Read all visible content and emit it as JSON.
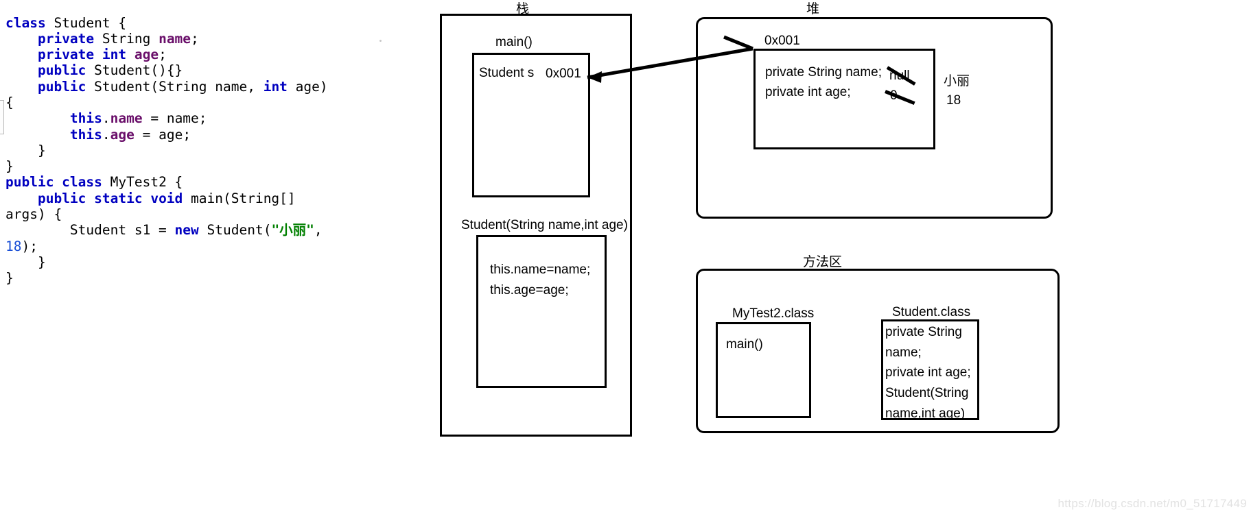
{
  "code": {
    "language": "java",
    "lines": [
      [
        {
          "t": "class ",
          "c": "kw"
        },
        {
          "t": "Student {",
          "c": "plain"
        }
      ],
      [
        {
          "t": "    ",
          "c": "plain"
        },
        {
          "t": "private ",
          "c": "kw"
        },
        {
          "t": "String ",
          "c": "plain"
        },
        {
          "t": "name",
          "c": "fld"
        },
        {
          "t": ";",
          "c": "plain"
        }
      ],
      [
        {
          "t": "    ",
          "c": "plain"
        },
        {
          "t": "private ",
          "c": "kw"
        },
        {
          "t": "int ",
          "c": "kw"
        },
        {
          "t": "age",
          "c": "fld"
        },
        {
          "t": ";",
          "c": "plain"
        }
      ],
      [
        {
          "t": "    ",
          "c": "plain"
        },
        {
          "t": "public ",
          "c": "kw"
        },
        {
          "t": "Student(){}",
          "c": "plain"
        }
      ],
      [
        {
          "t": "    ",
          "c": "plain"
        },
        {
          "t": "public ",
          "c": "kw"
        },
        {
          "t": "Student(String name, ",
          "c": "plain"
        },
        {
          "t": "int ",
          "c": "kw"
        },
        {
          "t": "age){",
          "c": "plain"
        }
      ],
      [
        {
          "t": "        ",
          "c": "plain"
        },
        {
          "t": "this",
          "c": "kw"
        },
        {
          "t": ".",
          "c": "plain"
        },
        {
          "t": "name",
          "c": "fld"
        },
        {
          "t": " = name;",
          "c": "plain"
        }
      ],
      [
        {
          "t": "        ",
          "c": "plain"
        },
        {
          "t": "this",
          "c": "kw"
        },
        {
          "t": ".",
          "c": "plain"
        },
        {
          "t": "age",
          "c": "fld"
        },
        {
          "t": " = age;",
          "c": "plain"
        }
      ],
      [
        {
          "t": "    }",
          "c": "plain"
        }
      ],
      [
        {
          "t": "}",
          "c": "plain"
        }
      ],
      [
        {
          "t": "public class ",
          "c": "kw"
        },
        {
          "t": "MyTest2 {",
          "c": "plain"
        }
      ],
      [
        {
          "t": "    ",
          "c": "plain"
        },
        {
          "t": "public static void ",
          "c": "kw"
        },
        {
          "t": "main(String[] args) {",
          "c": "plain"
        }
      ],
      [
        {
          "t": "        Student s1 = ",
          "c": "plain"
        },
        {
          "t": "new ",
          "c": "kw"
        },
        {
          "t": "Student(",
          "c": "plain"
        },
        {
          "t": "\"小丽\"",
          "c": "str"
        },
        {
          "t": ", ",
          "c": "plain"
        },
        {
          "t": "18",
          "c": "num"
        },
        {
          "t": ");",
          "c": "plain"
        }
      ],
      [
        {
          "t": "    }",
          "c": "plain"
        }
      ],
      [
        {
          "t": "}",
          "c": "plain"
        }
      ]
    ]
  },
  "diagram": {
    "stack": {
      "label": "栈",
      "main_frame": {
        "label": "main()",
        "variable": "Student s",
        "value": "0x001"
      },
      "constructor_frame": {
        "label": "Student(String name,int age)",
        "lines": [
          "this.name=name;",
          "this.age=age;"
        ]
      }
    },
    "heap": {
      "label": "堆",
      "object": {
        "address": "0x001",
        "fields": [
          "private String name;",
          "private int age;"
        ],
        "old_values": [
          "null",
          "0"
        ],
        "new_values": [
          "小丽",
          "18"
        ]
      }
    },
    "method_area": {
      "label": "方法区",
      "mytest_class": {
        "label": "MyTest2.class",
        "members": [
          "main()"
        ]
      },
      "student_class": {
        "label": "Student.class",
        "members": [
          "private String name;",
          "private int age;",
          "Student(String name,int age)"
        ]
      }
    }
  },
  "watermark": "https://blog.csdn.net/m0_51717449"
}
